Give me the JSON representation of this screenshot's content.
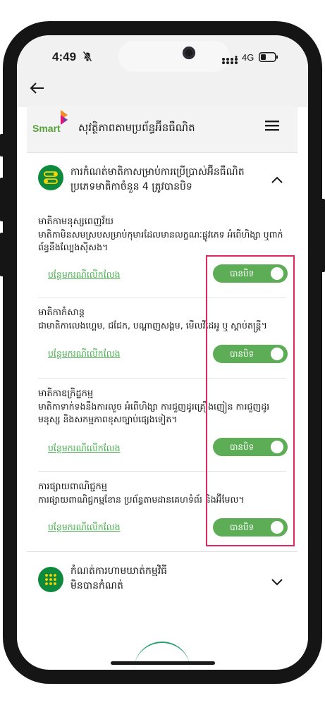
{
  "status_bar": {
    "time": "4:49",
    "network": "4G"
  },
  "header": {
    "title": "សុវត្ថិភាពតាមប្រព័ន្ធអ៊ីនធឺណិត",
    "logo_text": "Smart"
  },
  "content_filter": {
    "title_line1": "ការកំណត់មាតិកាសម្រាប់ការប្រើប្រាស់អ៊ីនធឺណិត",
    "title_line2": "ប្រភេទមាតិកាចំនួន 4 ត្រូវបានបិទ",
    "link_label": "បន្ថែមករណីលើកលែង",
    "toggle_label": "បានបិទ",
    "categories": [
      {
        "title": "មាតិកាមនុស្សពេញវ័យ",
        "description": "មាតិកាមិនសមស្របសម្រាប់កុមារដែលមានលក្ខណៈផ្លូវភេទ អំពើហិង្សា ឬពាក់ព័ន្ធនឹងល្បែងស៊ីសង។"
      },
      {
        "title": "មាតិកាកំសាន្ត",
        "description": "ជាមាតិកាលេងហ្គេម, ជជែក, បណ្ដាញសង្គម, មើលវីដេអូ ឬ ស្ដាប់តន្ត្រី។"
      },
      {
        "title": "មាតិកាឧក្រិដ្ឋកម្ម",
        "description": "មាតិកាទាក់ទងនឹងការលួច អំពើហិង្សា ការជួញដូរគ្រឿងញៀន ការជួញដូរមនុស្ស និងសកម្មភាពខុសច្បាប់ផ្សេងទៀត។"
      },
      {
        "title": "ការផ្សាយពាណិជ្ជកម្ម",
        "description": "ការផ្សាយពាណិជ្ជកម្មខែាន ប្រព័ន្ធតាមដានគេហទំព័រ និងអ៊ីមែល។"
      }
    ]
  },
  "app_blocking": {
    "title_line1": "កំណត់ការហាមឃាត់កម្មវិធី",
    "title_line2": "មិនបានកំណត់"
  },
  "colors": {
    "brand_green": "#0e8a3c",
    "toggle_green": "#5cad55",
    "link_green": "#4caf50",
    "highlight_pink": "#e1285e"
  },
  "icons": {
    "back": "arrow-left-icon",
    "menu": "hamburger-icon",
    "filter": "toggles-icon",
    "apps": "grid-icon",
    "expand": "chevron-up-icon",
    "collapse": "chevron-down-icon"
  }
}
